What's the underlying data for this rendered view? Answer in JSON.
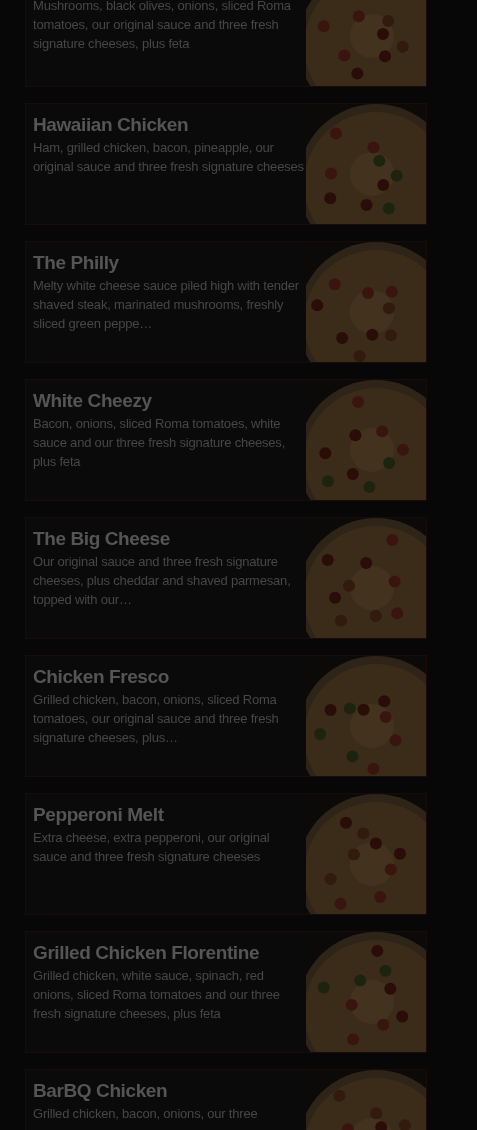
{
  "menu_items": [
    {
      "description": "Mushrooms, black olives, onions, sliced Roma tomatoes, our original sauce and three fresh signature cheeses, plus feta"
    },
    {
      "title": "Hawaiian Chicken",
      "description": "Ham, grilled chicken, bacon, pineapple, our original sauce and three fresh signature cheeses"
    },
    {
      "title": "The Philly",
      "description": "Melty white cheese sauce piled high with tender shaved steak, marinated mushrooms, freshly sliced green peppe…"
    },
    {
      "title": "White Cheezy",
      "description": "Bacon, onions, sliced Roma tomatoes, white sauce and our three fresh signature cheeses, plus feta"
    },
    {
      "title": "The Big Cheese",
      "description": "Our original sauce and three fresh signature cheeses, plus cheddar and shaved parmesan, topped with our…"
    },
    {
      "title": "Chicken Fresco",
      "description": "Grilled chicken, bacon, onions, sliced Roma tomatoes, our original sauce and three fresh signature cheeses, plus…"
    },
    {
      "title": "Pepperoni Melt",
      "description": "Extra cheese, extra pepperoni, our original sauce and three fresh signature cheeses"
    },
    {
      "title": "Grilled Chicken Florentine",
      "description": "Grilled chicken, white sauce, spinach, red onions, sliced Roma tomatoes and our three fresh signature cheeses, plus feta"
    },
    {
      "title": "BarBQ Chicken",
      "description": "Grilled chicken, bacon, onions, our three"
    }
  ]
}
